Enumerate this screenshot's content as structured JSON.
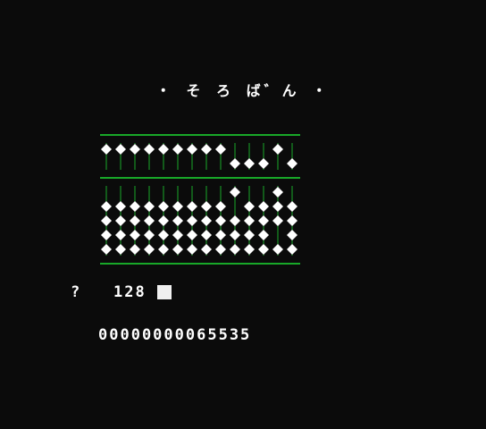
{
  "title": "・ そ ろ ば゛ん ・",
  "prompt": {
    "marker": "?",
    "input_value": "128"
  },
  "result": "00000000065535",
  "abacus": {
    "digits": [
      0,
      0,
      0,
      0,
      0,
      0,
      0,
      0,
      0,
      6,
      5,
      5,
      3,
      5
    ],
    "colors": {
      "frame": "#18a828",
      "rod": "#18a828",
      "bead": "#ffffff",
      "background": "#0b0b0b"
    }
  }
}
